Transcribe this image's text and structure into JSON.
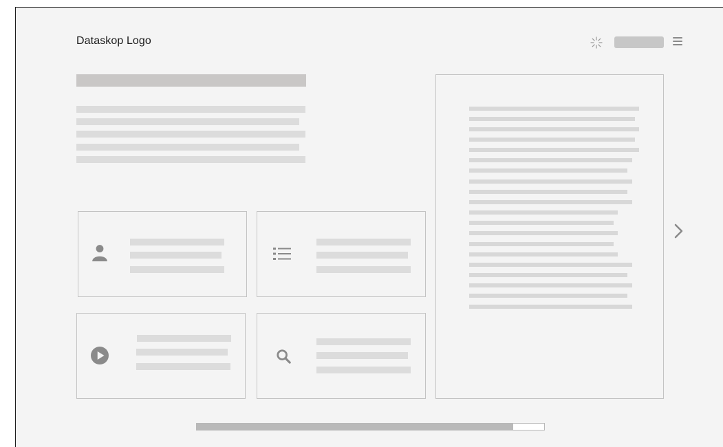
{
  "header": {
    "logo_text": "Dataskop Logo",
    "icons": [
      "loading-spinner-icon",
      "menu-icon"
    ]
  },
  "cards": [
    {
      "icon": "user-icon"
    },
    {
      "icon": "list-icon"
    },
    {
      "icon": "play-icon"
    },
    {
      "icon": "search-icon"
    }
  ],
  "navigation": {
    "next_icon": "chevron-right-icon"
  },
  "progress": {
    "fraction": 0.91
  },
  "colors": {
    "background": "#f4f4f4",
    "placeholder": "#dcdcdc",
    "border": "#c3c3c3",
    "icon": "#8a8a8a"
  }
}
